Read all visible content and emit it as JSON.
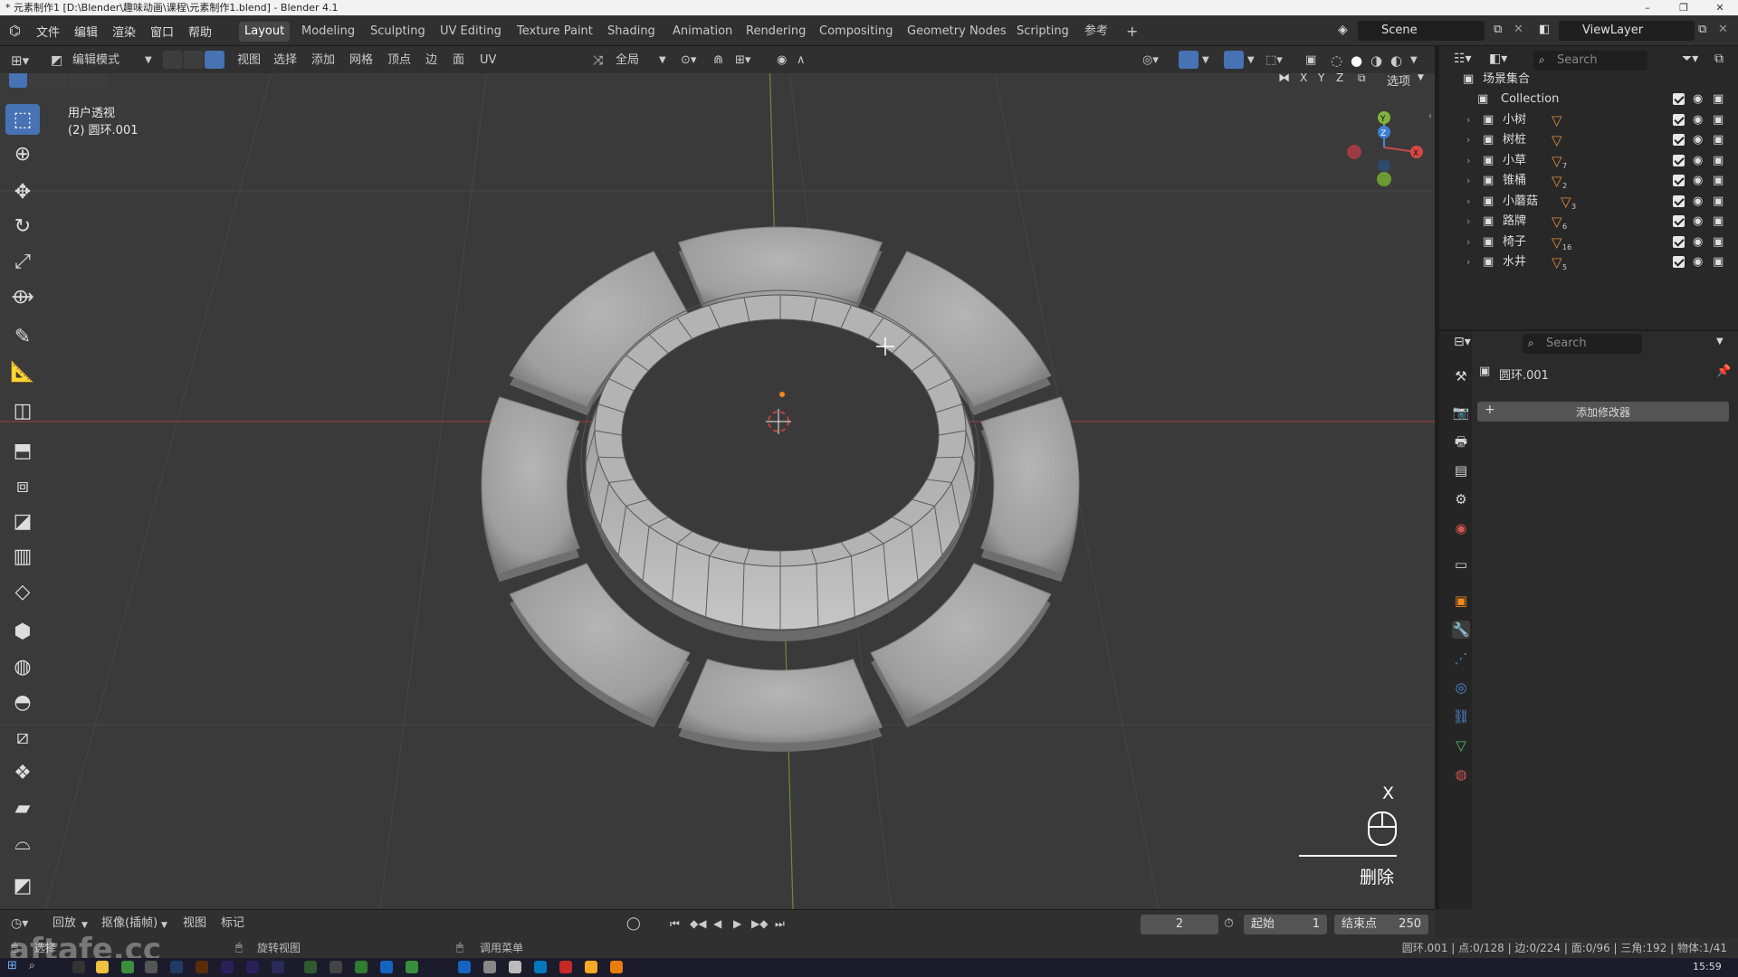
{
  "window": {
    "title": "* 元素制作1 [D:\\Blender\\趣味动画\\课程\\元素制作1.blend] - Blender 4.1",
    "controls": [
      "–",
      "❐",
      "✕"
    ]
  },
  "menus": [
    "文件",
    "编辑",
    "渲染",
    "窗口",
    "帮助"
  ],
  "workspaces": [
    "Layout",
    "Modeling",
    "Sculpting",
    "UV Editing",
    "Texture Paint",
    "Shading",
    "Animation",
    "Rendering",
    "Compositing",
    "Geometry Nodes",
    "Scripting",
    "参考"
  ],
  "active_workspace": "Layout",
  "scene": "Scene",
  "view_layer": "ViewLayer",
  "viewport_header": {
    "mode": "编辑模式",
    "menus": [
      "视图",
      "选择",
      "添加",
      "网格",
      "顶点",
      "边",
      "面",
      "UV"
    ],
    "transform_orientation": "全局",
    "axis_x": "X",
    "axis_y": "Y",
    "axis_z": "Z",
    "options": "选项"
  },
  "viewport": {
    "view_name": "用户透视",
    "object_label": "(2) 圆环.001",
    "gizmo_y": "Y",
    "gizmo_z": "Z",
    "gizmo_x": "X",
    "key_hint_key": "X",
    "key_hint_action": "删除"
  },
  "outliner": {
    "search_placeholder": "Search",
    "root": "场景集合",
    "items": [
      {
        "name": "Collection",
        "badge": ""
      },
      {
        "name": "小树",
        "badge": ""
      },
      {
        "name": "树桩",
        "badge": ""
      },
      {
        "name": "小草",
        "badge": "7"
      },
      {
        "name": "锥桶",
        "badge": "2"
      },
      {
        "name": "小蘑菇",
        "badge": "3"
      },
      {
        "name": "路牌",
        "badge": "6"
      },
      {
        "name": "椅子",
        "badge": "16"
      },
      {
        "name": "水井",
        "badge": "5"
      }
    ]
  },
  "properties": {
    "search_placeholder": "Search",
    "object_name": "圆环.001",
    "add_modifier": "添加修改器"
  },
  "timeline": {
    "playback": "回放",
    "keying": "抠像(插帧)",
    "view": "视图",
    "marker": "标记",
    "current_frame": "2",
    "start_label": "起始",
    "start_value": "1",
    "end_label": "结束点",
    "end_value": "250"
  },
  "statusbar": {
    "left": "选择",
    "middle1": "旋转视图",
    "middle2": "调用菜单",
    "stats": "圆环.001 | 点:0/128 | 边:0/224 | 面:0/96 | 三角:192 | 物体:1/41"
  },
  "taskbar": {
    "time": "15:59"
  },
  "watermark": "aftafe.cc"
}
